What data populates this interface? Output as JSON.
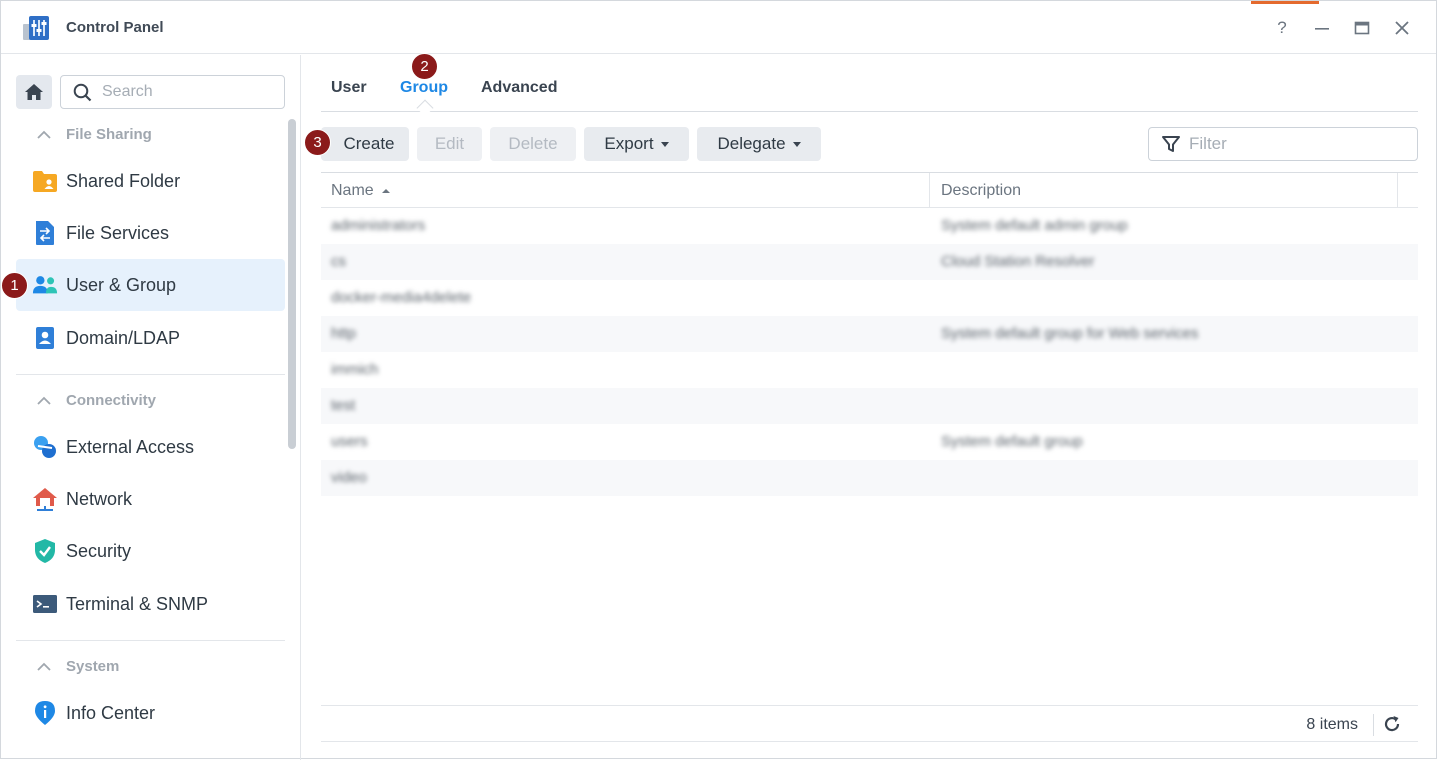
{
  "window": {
    "title": "Control Panel",
    "controls": {
      "help": "?",
      "minimize": "—",
      "maximize": "▭",
      "close": "✕"
    }
  },
  "sidebar": {
    "search_placeholder": "Search",
    "sections": [
      {
        "label": "File Sharing",
        "items": [
          {
            "label": "Shared Folder",
            "icon": "shared-folder-icon"
          },
          {
            "label": "File Services",
            "icon": "file-services-icon"
          },
          {
            "label": "User & Group",
            "icon": "user-group-icon",
            "active": true
          },
          {
            "label": "Domain/LDAP",
            "icon": "domain-ldap-icon"
          }
        ]
      },
      {
        "label": "Connectivity",
        "items": [
          {
            "label": "External Access",
            "icon": "external-access-icon"
          },
          {
            "label": "Network",
            "icon": "network-icon"
          },
          {
            "label": "Security",
            "icon": "security-icon"
          },
          {
            "label": "Terminal & SNMP",
            "icon": "terminal-icon"
          }
        ]
      },
      {
        "label": "System",
        "items": [
          {
            "label": "Info Center",
            "icon": "info-center-icon"
          }
        ]
      }
    ]
  },
  "badges": {
    "b1": "1",
    "b2": "2",
    "b3": "3"
  },
  "tabs": [
    {
      "label": "User"
    },
    {
      "label": "Group",
      "active": true
    },
    {
      "label": "Advanced"
    }
  ],
  "toolbar": {
    "create": "Create",
    "edit": "Edit",
    "delete": "Delete",
    "export": "Export",
    "delegate": "Delegate",
    "filter_placeholder": "Filter"
  },
  "grid": {
    "columns": {
      "name": "Name",
      "description": "Description"
    },
    "rows": [
      {
        "name": "administrators",
        "description": "System default admin group"
      },
      {
        "name": "cs",
        "description": "Cloud Station Resolver"
      },
      {
        "name": "docker-media4delete",
        "description": ""
      },
      {
        "name": "http",
        "description": "System default group for Web services"
      },
      {
        "name": "immich",
        "description": ""
      },
      {
        "name": "test",
        "description": ""
      },
      {
        "name": "users",
        "description": "System default group"
      },
      {
        "name": "video",
        "description": ""
      }
    ]
  },
  "footer": {
    "count": "8 items"
  },
  "colors": {
    "accent": "#1e88e5",
    "badge": "#8b1a1a",
    "active_bg": "#e6f1fc"
  }
}
